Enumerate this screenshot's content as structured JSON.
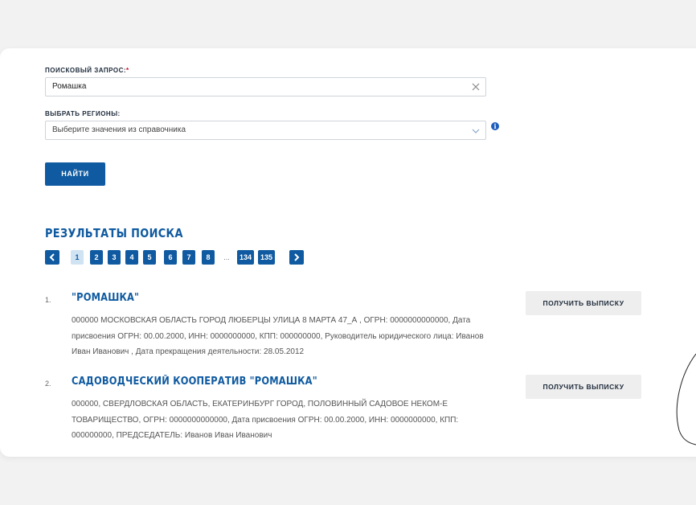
{
  "form": {
    "query_label": "ПОИСКОВЫЙ ЗАПРОС:",
    "required_mark": "*",
    "query_value": "Ромашка",
    "regions_label": "ВЫБРАТЬ РЕГИОНЫ:",
    "regions_placeholder": "Выберите значения из справочника",
    "info_symbol": "i",
    "find_button": "НАЙТИ"
  },
  "results": {
    "title": "РЕЗУЛЬТАТЫ ПОИСКА",
    "pagination": {
      "pages": [
        "1",
        "2",
        "3",
        "4",
        "5",
        "6",
        "7",
        "8"
      ],
      "ellipsis": "...",
      "last_pages": [
        "134",
        "135"
      ],
      "current": "1"
    },
    "items": [
      {
        "num": "1.",
        "title": "\"РОМАШКА\"",
        "desc": "000000 МОСКОВСКАЯ ОБЛАСТЬ ГОРОД ЛЮБЕРЦЫ УЛИЦА 8 МАРТА 47_А , ОГРН: 0000000000000, Дата присвоения ОГРН: 00.00.2000, ИНН: 0000000000, КПП: 000000000, Руководитель юридического лица: Иванов Иван Иванович , Дата прекращения деятельности: 28.05.2012",
        "button": "ПОЛУЧИТЬ ВЫПИСКУ"
      },
      {
        "num": "2.",
        "title": "САДОВОДЧЕСКИЙ КООПЕРАТИВ \"РОМАШКА\"",
        "desc": "000000, СВЕРДЛОВСКАЯ ОБЛАСТЬ, ЕКАТЕРИНБУРГ ГОРОД, ПОЛОВИННЫЙ САДОВОЕ НЕКОМ-Е ТОВАРИЩЕСТВО, ОГРН: 0000000000000, Дата присвоения ОГРН: 00.00.2000, ИНН: 0000000000, КПП: 000000000, ПРЕДСЕДАТЕЛЬ: Иванов Иван Иванович",
        "button": "ПОЛУЧИТЬ ВЫПИСКУ"
      }
    ]
  },
  "colors": {
    "accent": "#0f5aa0",
    "active_page_bg": "#cfe3f3",
    "required": "#d0021b"
  },
  "icons": {
    "clear": "close-icon",
    "dropdown": "chevron-down-icon",
    "info": "info-icon",
    "prev": "chevron-left-icon",
    "next": "chevron-right-icon"
  }
}
